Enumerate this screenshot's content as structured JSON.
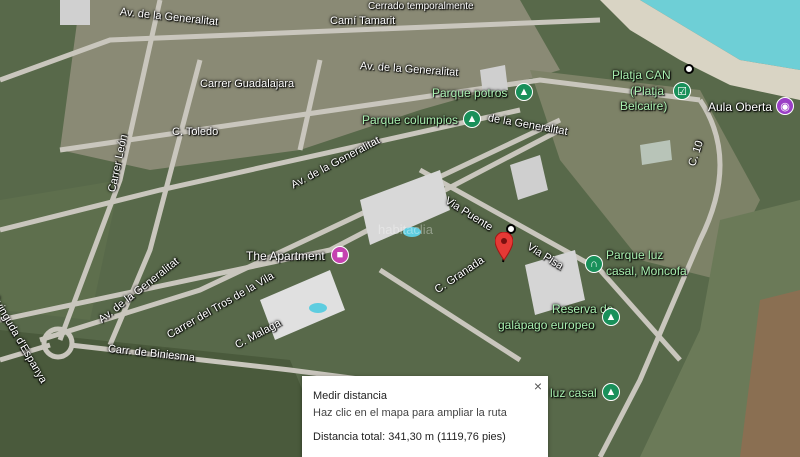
{
  "colors": {
    "sea": "#6ecfd6",
    "sand": "#d9d4c4",
    "road": "#c9c6bd",
    "vegetation": "#566b4a",
    "measure_line": "#000000",
    "pin_red": "#e53935",
    "poi_green_text": "#a9f0b0",
    "poi_green_pin": "#19905a",
    "poi_pink_pin": "#c541b0"
  },
  "streets": {
    "generalitat_top": "Av. de la Generalitat",
    "camí_tamarit": "Camí Tamarit",
    "cerrado": "Cerrado temporalmente",
    "av_generalitat_mid": "Av. de la Generalitat",
    "guadalajara": "Carrer Guadalajara",
    "toledo": "C. Toledo",
    "leon": "Carrer León",
    "generalitat_diag": "Av. de la Generalitat",
    "generalitat_left": "Av. de la Generalitat",
    "generalitat_right": "de la Generalitat",
    "via_puente": "Via Puente",
    "via_pisa": "Via Pisa",
    "c_granada": "C. Granada",
    "c_10": "C. 10",
    "tros_vila": "Carrer del Tros de la Vila",
    "c_malaga": "C. Malaga",
    "biniesma": "Carr. de Biniesma",
    "espanya": "Avinguda d'Espanya"
  },
  "pois": {
    "parque_potros": {
      "label": "Parque potros",
      "icon": "tree-icon"
    },
    "parque_columpios": {
      "label": "Parque columpios",
      "icon": "tree-icon"
    },
    "platja_can": {
      "label_line1": "Platja CAN",
      "label_line2": "(Platja",
      "label_line3": "Belcaire)",
      "icon": "beach-icon"
    },
    "aula_oberta": {
      "label": "Aula Oberta",
      "icon": "camera-icon"
    },
    "the_apartment": {
      "label": "The Apartment",
      "icon": "bed-icon"
    },
    "parque_luz": {
      "label_line1": "Parque luz",
      "label_line2": "casal, Moncofa",
      "icon": "playground-icon"
    },
    "reserva": {
      "label_line1": "Reserva de",
      "label_line2": "galápago europeo",
      "icon": "tree-icon"
    },
    "luz_casal": {
      "label": "luz casal",
      "icon": "tree-icon"
    }
  },
  "measure_panel": {
    "title": "Medir distancia",
    "help": "Haz clic en el mapa para ampliar la ruta",
    "total": "Distancia total: 341,30 m (1119,76 pies)",
    "close": "×"
  },
  "watermark": "habitaclia"
}
